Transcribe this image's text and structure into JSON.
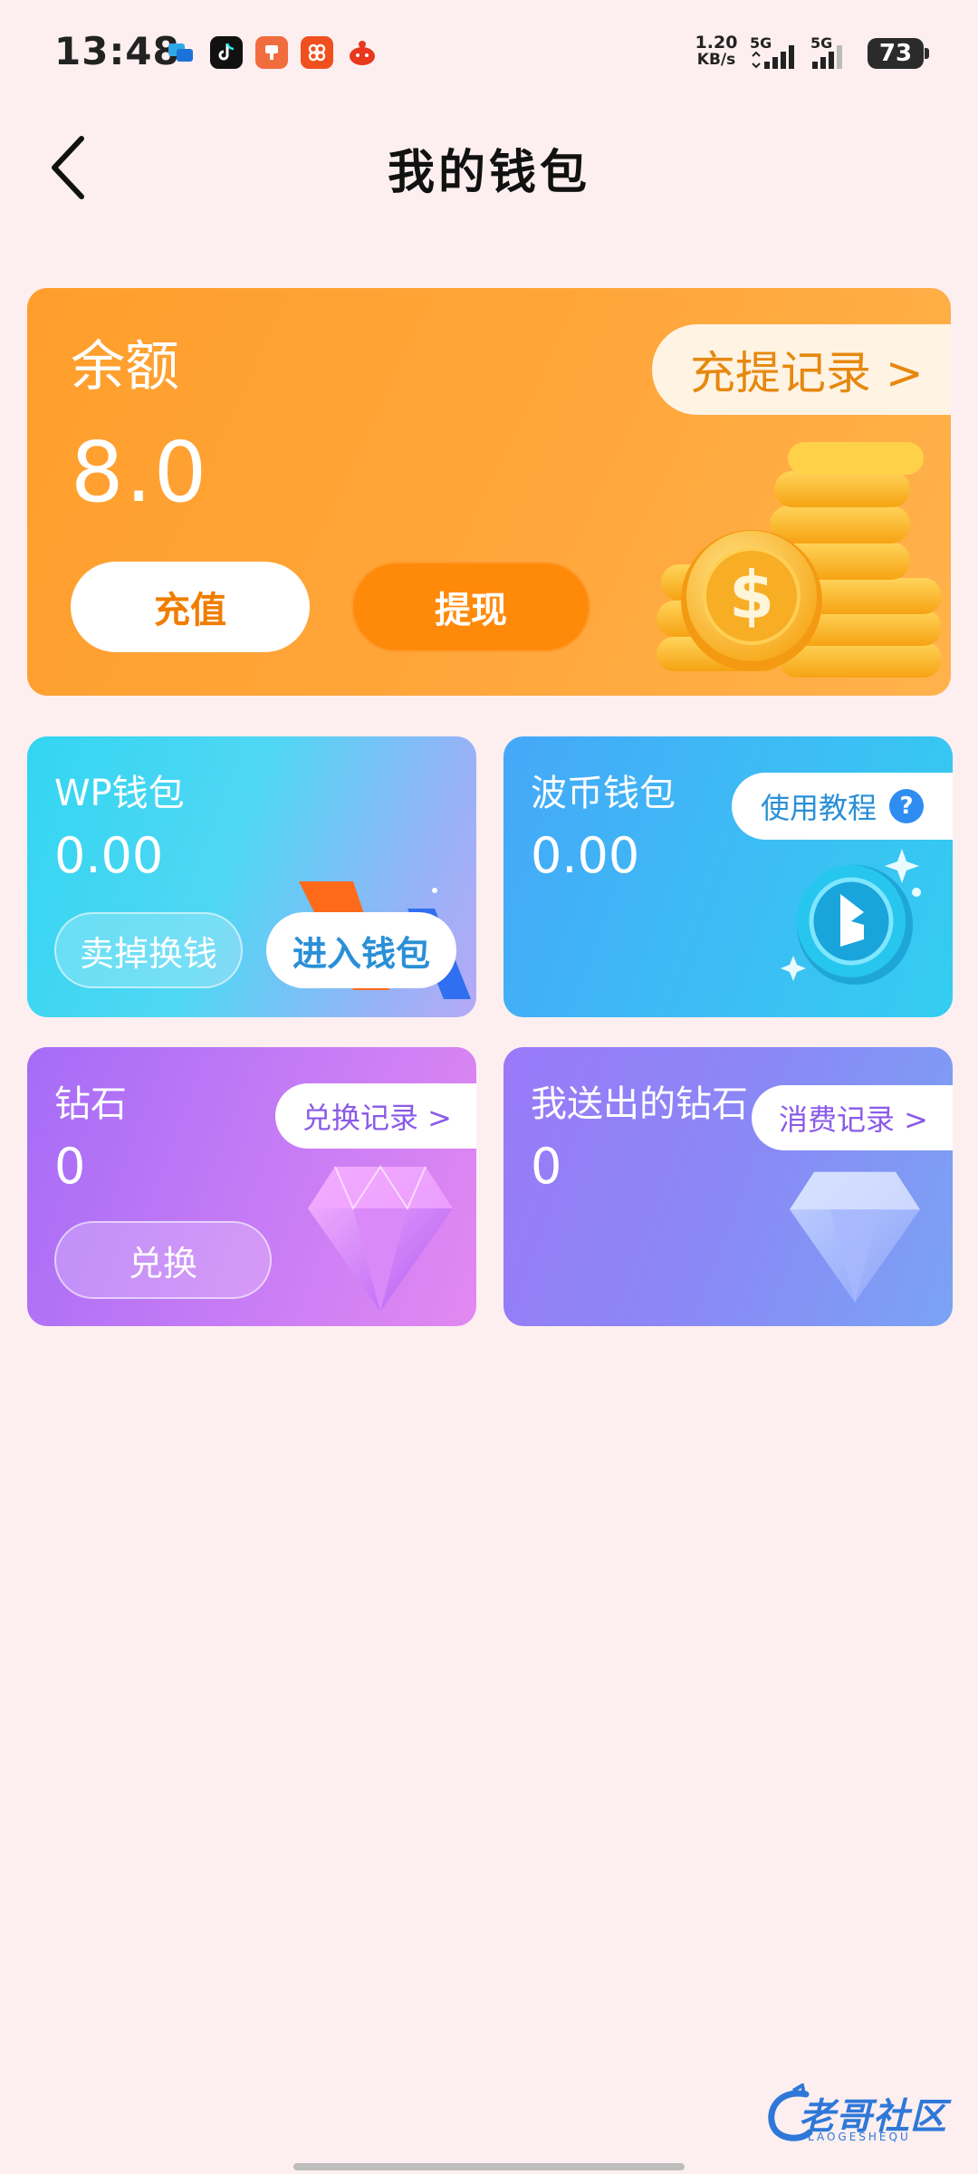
{
  "status_bar": {
    "time": "13:48",
    "net_speed_value": "1.20",
    "net_speed_unit": "KB/s",
    "sim1_label": "5G",
    "sim2_label": "5G",
    "battery": "73",
    "notification_icons": [
      "message-icon",
      "tiktok-icon",
      "app-icon",
      "app-icon",
      "app-icon"
    ]
  },
  "header": {
    "title": "我的钱包"
  },
  "balance_card": {
    "label": "余额",
    "amount": "8.0",
    "record_link": "充提记录 >",
    "recharge_label": "充值",
    "withdraw_label": "提现"
  },
  "wp_wallet": {
    "title": "WP钱包",
    "value": "0.00",
    "sell_label": "卖掉换钱",
    "enter_label": "进入钱包"
  },
  "bo_wallet": {
    "title": "波币钱包",
    "value": "0.00",
    "tutorial_label": "使用教程",
    "help_symbol": "?"
  },
  "diamond": {
    "title": "钻石",
    "value": "0",
    "record_link": "兑换记录 >",
    "exchange_label": "兑换"
  },
  "sent_diamond": {
    "title": "我送出的钻石",
    "value": "0",
    "record_link": "消费记录 >"
  },
  "watermark": {
    "text": "老哥社区",
    "subtext": "LAOGESHEQU"
  },
  "colors": {
    "background": "#fdeff0",
    "balance_orange": "#ffa63a",
    "record_text_orange": "#e6880f",
    "wp_blue": "#2a8fd6",
    "purple_text": "#8a5ae8"
  }
}
